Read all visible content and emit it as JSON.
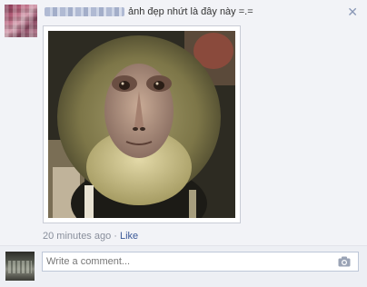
{
  "post": {
    "status_text": "ảnh đẹp nhứt là đây này =.=",
    "close_icon": "close-icon",
    "photo_alt": "monkey photo"
  },
  "meta": {
    "time": "20 minutes ago",
    "separator": " · ",
    "like_label": "Like"
  },
  "comment": {
    "placeholder": "Write a comment...",
    "value": "",
    "camera_icon": "camera-icon"
  }
}
